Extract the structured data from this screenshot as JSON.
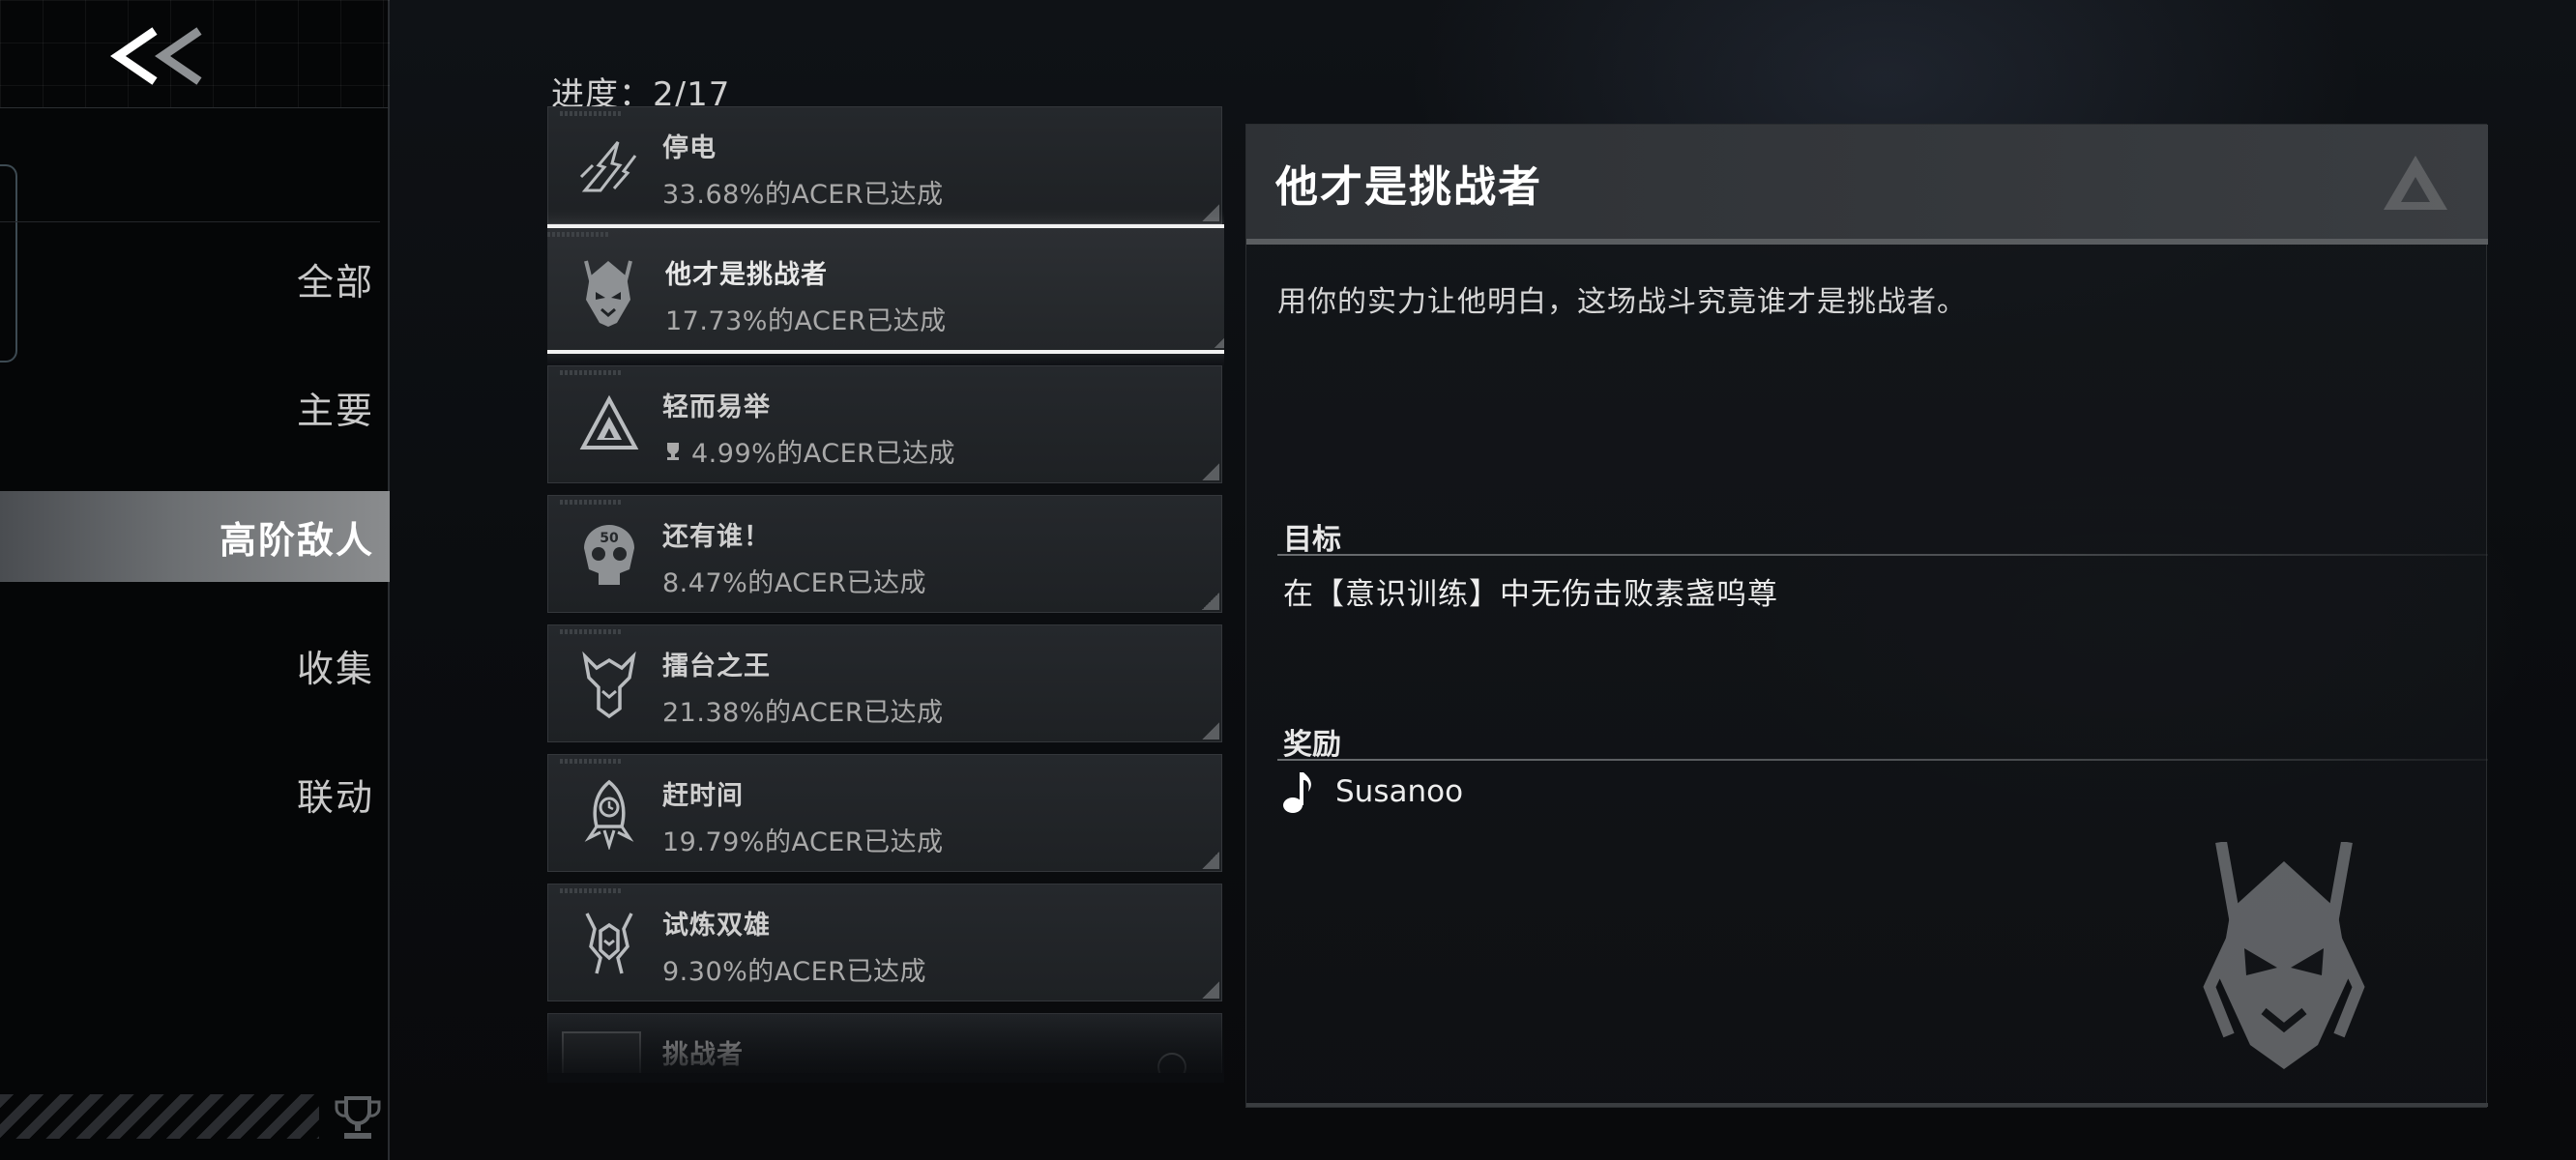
{
  "nav": {
    "back_icon": "double-chevron-left-icon",
    "items": [
      {
        "label": "全部"
      },
      {
        "label": "主要"
      },
      {
        "label": "高阶敌人"
      },
      {
        "label": "收集"
      },
      {
        "label": "联动"
      }
    ],
    "active_index": 2
  },
  "progress": {
    "label": "进度：2/17"
  },
  "achievements": [
    {
      "name": "停电",
      "rate": "33.68%的ACER已达成",
      "icon": "lightning-claw-icon"
    },
    {
      "name": "他才是挑战者",
      "rate": "17.73%的ACER已达成",
      "icon": "demon-mask-icon",
      "selected": true
    },
    {
      "name": "轻而易举",
      "rate": "4.99%的ACER已达成",
      "icon": "triangle-emblem-icon",
      "trophy": true
    },
    {
      "name": "还有谁！",
      "rate": "8.47%的ACER已达成",
      "icon": "skull-50-icon"
    },
    {
      "name": "擂台之王",
      "rate": "21.38%的ACER已达成",
      "icon": "crowned-beast-icon"
    },
    {
      "name": "赶时间",
      "rate": "19.79%的ACER已达成",
      "icon": "rocket-clock-icon"
    },
    {
      "name": "试炼双雄",
      "rate": "9.30%的ACER已达成",
      "icon": "twin-mask-icon"
    },
    {
      "name": "挑战者",
      "rate": "",
      "icon": "locked-icon",
      "locked": true
    }
  ],
  "detail": {
    "title": "他才是挑战者",
    "description": "用你的实力让他明白，这场战斗究竟谁才是挑战者。",
    "goal_label": "目标",
    "goal_text": "在【意识训练】中无伤击败素盏呜尊",
    "reward_label": "奖励",
    "reward_icon": "music-note-icon",
    "reward_name": "Susanoo"
  },
  "colors": {
    "accent_white": "#f2f2f2",
    "active_nav": "#6c6f72",
    "panel_header": "#35383c"
  }
}
